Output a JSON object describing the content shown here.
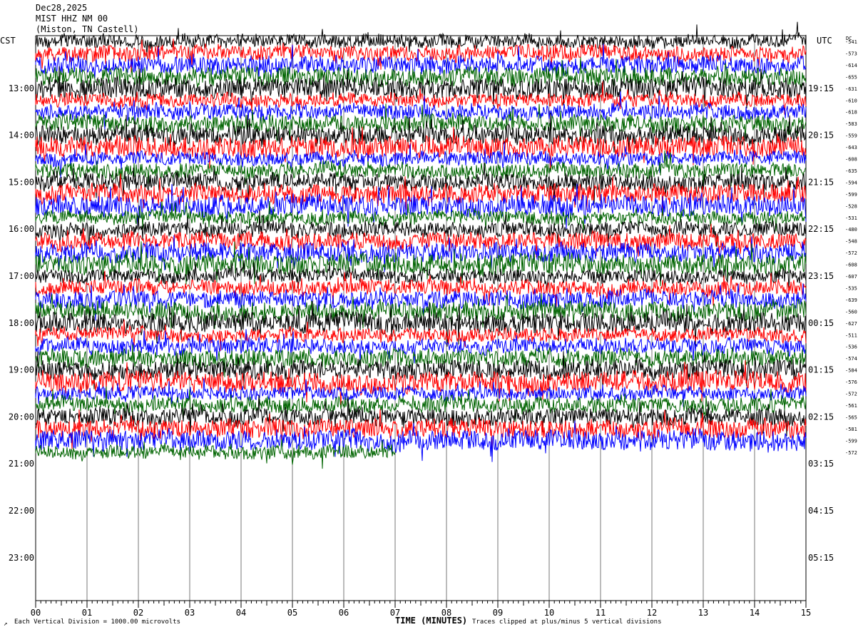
{
  "header": {
    "date": "Dec28,2025",
    "station": "MIST HHZ NM 00",
    "location": "(Miston, TN Castell)"
  },
  "labels": {
    "left_tz": "CST",
    "right_tz": "UTC",
    "dc": "DC"
  },
  "footer": {
    "scale_note": "Each Vertical Division = 1000.00 microvolts",
    "clip_note": "Traces clipped at plus/minus 5 vertical divisions",
    "corner_mark": "↗"
  },
  "chart_data": {
    "type": "line",
    "title": "MIST HHZ NM 00",
    "xlabel": "TIME (MINUTES)",
    "x_ticks": [
      "00",
      "01",
      "02",
      "03",
      "04",
      "05",
      "06",
      "07",
      "08",
      "09",
      "10",
      "11",
      "12",
      "13",
      "14",
      "15"
    ],
    "xlim": [
      0,
      15
    ],
    "left_hour_labels": [
      "13:00",
      "14:00",
      "15:00",
      "16:00",
      "17:00",
      "18:00",
      "19:00",
      "20:00",
      "21:00",
      "22:00",
      "23:00"
    ],
    "right_hour_labels": [
      "19:15",
      "20:15",
      "21:15",
      "22:15",
      "23:15",
      "00:15",
      "01:15",
      "02:15",
      "03:15",
      "04:15",
      "05:15"
    ],
    "trace_colors": [
      "#000000",
      "#ff0000",
      "#0000ff",
      "#006400"
    ],
    "trace_count": 36,
    "last_trace_end_minute": 7,
    "dc_offsets": [
      "-541",
      "-573",
      "-614",
      "-655",
      "-631",
      "-610",
      "-618",
      "-583",
      "-559",
      "-643",
      "-608",
      "-635",
      "-594",
      "-599",
      "-528",
      "-531",
      "-480",
      "-548",
      "-572",
      "-608",
      "-607",
      "-535",
      "-639",
      "-560",
      "-627",
      "-511",
      "-536",
      "-574",
      "-584",
      "-576",
      "-572",
      "-561",
      "-565",
      "-581",
      "-599",
      "-572"
    ]
  }
}
